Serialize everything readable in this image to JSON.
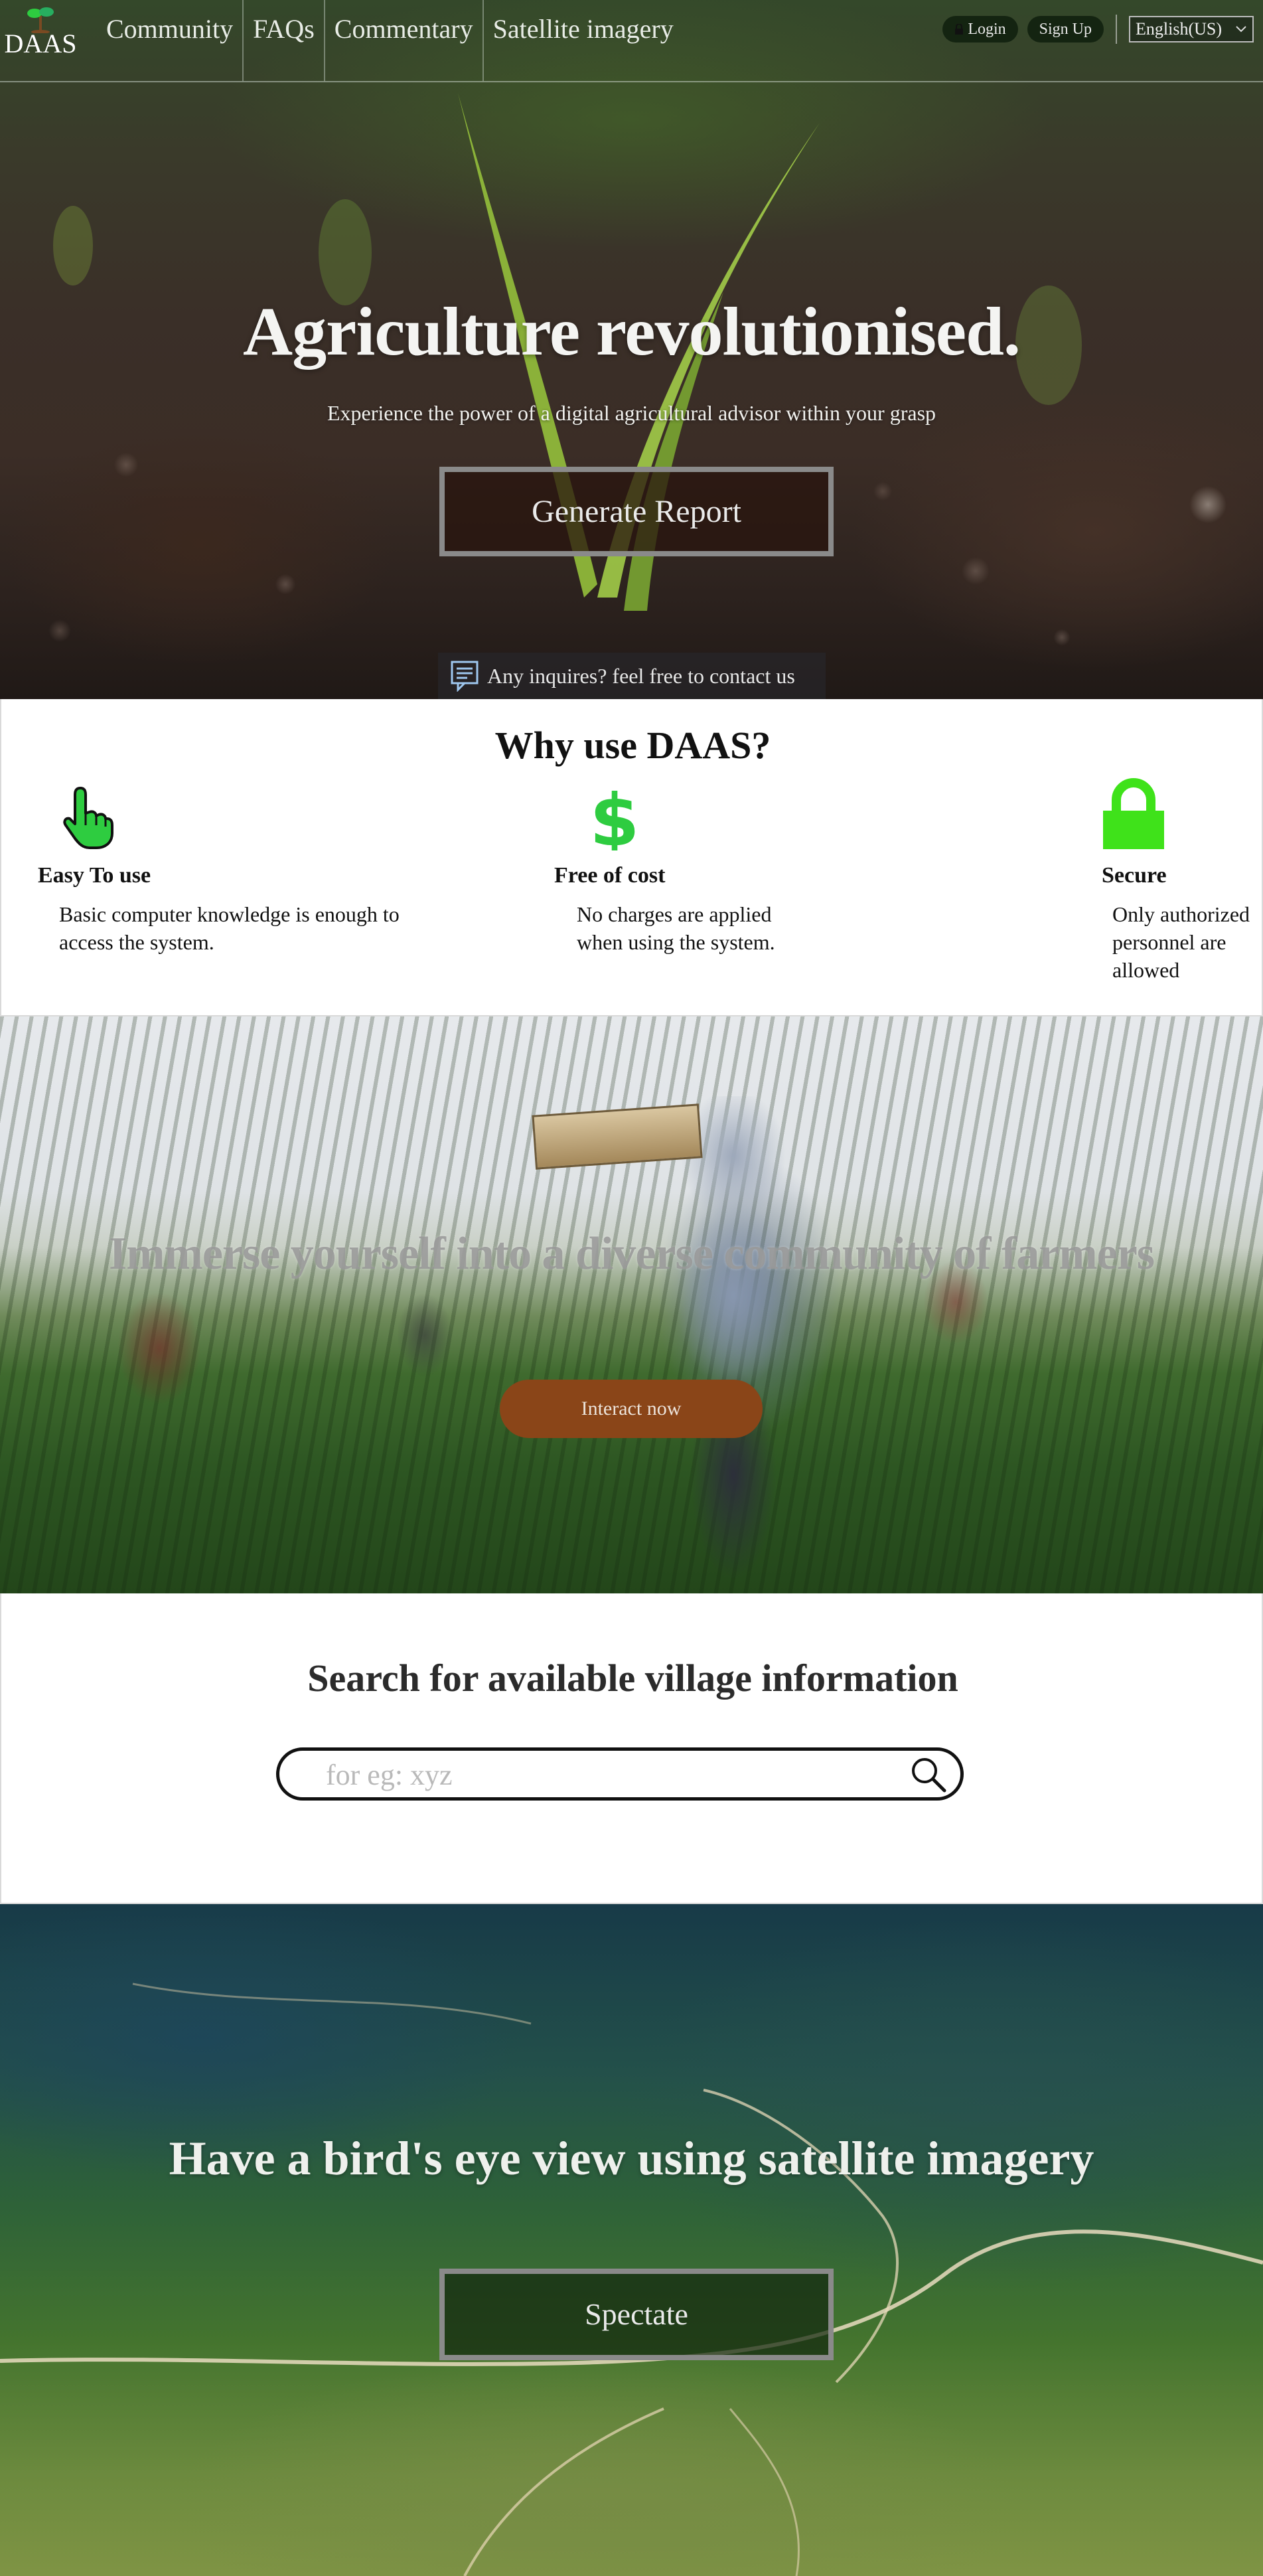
{
  "nav": {
    "brand": "DAAS",
    "links": [
      "Community",
      "FAQs",
      "Commentary",
      "Satellite imagery"
    ],
    "login_label": "Login",
    "signup_label": "Sign Up",
    "language": "English(US)"
  },
  "hero": {
    "title": "Agriculture revolutionised.",
    "subtitle": "Experience the power of a digital  agricultural advisor within your grasp",
    "button_label": "Generate Report",
    "contact_text": "Any inquires? feel free to contact us"
  },
  "why": {
    "title": "Why use DAAS?",
    "features": [
      {
        "icon": "pointer-hand-icon",
        "title": "Easy To use",
        "desc": "Basic computer knowledge is enough to access the system."
      },
      {
        "icon": "dollar-icon",
        "title": "Free of cost",
        "desc": "No charges are applied when using the system."
      },
      {
        "icon": "lock-icon",
        "title": "Secure",
        "desc": "Only authorized personnel are allowed"
      }
    ]
  },
  "community": {
    "title": "Immerse yourself into a diverse community of farmers",
    "button_label": "Interact now"
  },
  "search": {
    "title": "Search for available village information",
    "placeholder": "for eg: xyz"
  },
  "satellite": {
    "title": "Have a bird's eye view using satellite imagery",
    "button_label": "Spectate"
  },
  "colors": {
    "accent_green": "#2ecc40",
    "interact_brown": "#8a4518"
  }
}
